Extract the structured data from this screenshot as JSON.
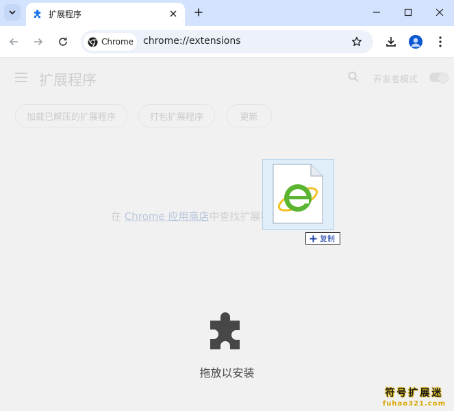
{
  "tab": {
    "title": "扩展程序"
  },
  "address": {
    "chip_label": "Chrome",
    "url": "chrome://extensions"
  },
  "extensions": {
    "title": "扩展程序",
    "developer_mode_label": "开发者模式",
    "developer_mode": false,
    "buttons": [
      "加载已解压的扩展程序",
      "打包扩展程序",
      "更新"
    ],
    "store_prefix": "在",
    "store_link": "Chrome 应用商店",
    "store_suffix": "中查找扩展程序和主题背景",
    "drop_label": "拖放以安装"
  },
  "drag": {
    "copy_label": "复制"
  },
  "watermark": {
    "name": "符号扩展迷",
    "url": "fuhao321.com"
  },
  "colors": {
    "tabstrip": "#d3e3fd",
    "accent": "#0b57d0",
    "page": "#f1f1f1",
    "watermark": "#d8a800"
  },
  "icons": [
    "chevron-down-icon",
    "extension-puzzle-icon",
    "close-icon",
    "plus-icon",
    "minimize-icon",
    "maximize-icon",
    "back-icon",
    "forward-icon",
    "reload-icon",
    "chrome-logo-icon",
    "star-icon",
    "download-icon",
    "profile-icon",
    "more-vert-icon",
    "menu-icon",
    "search-icon",
    "ie-file-icon"
  ]
}
